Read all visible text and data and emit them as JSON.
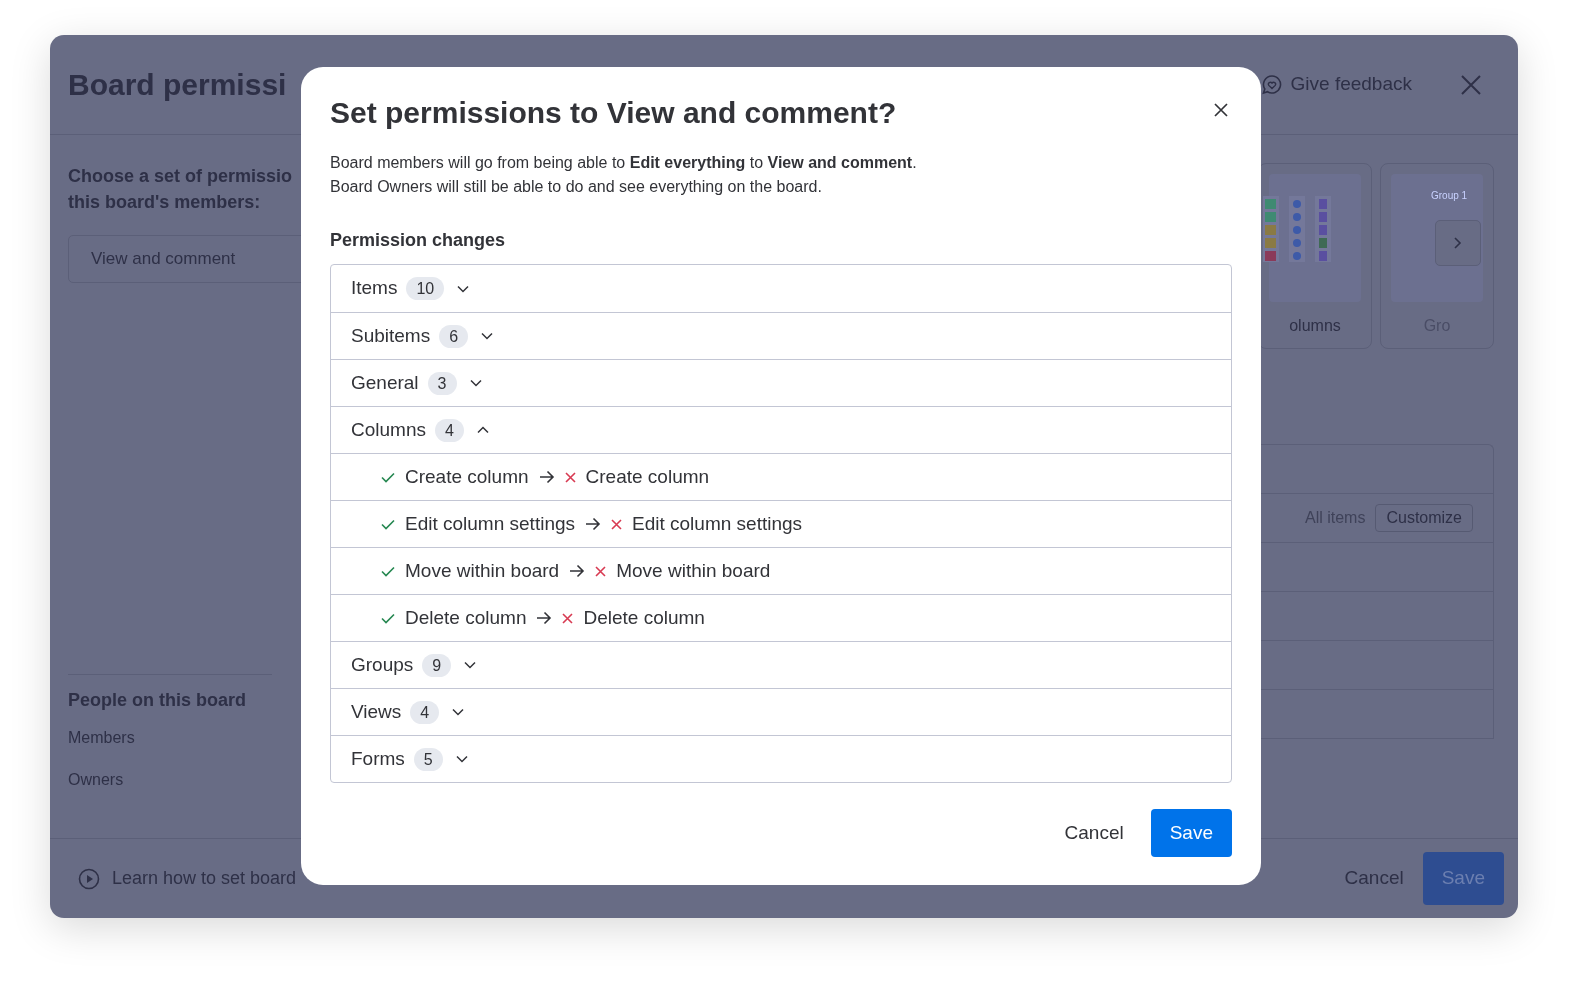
{
  "backdrop": {
    "title": "Board permissi",
    "feedback": "Give feedback",
    "prompt_lines": [
      "Choose a set of permissio",
      "this board's members:"
    ],
    "preset_field": "View and comment",
    "thumbnails": [
      {
        "label": "olumns",
        "kind": "columns"
      },
      {
        "label": "Gro",
        "kind": "groups",
        "preview_text": "Group 1"
      }
    ],
    "view_label": "All items",
    "customize": "Customize",
    "people": {
      "heading": "People on this board",
      "items": [
        "Members",
        "Owners"
      ]
    },
    "learn_link": "Learn how to set board",
    "buttons": [
      "Cancel",
      "Save"
    ]
  },
  "dialog": {
    "title": "Set permissions to View and comment?",
    "description": [
      "Board members will go from being able to **Edit everything** to **View and comment**.",
      "Board Owners will still be able to do and see everything on the board."
    ],
    "section_title": "Permission changes",
    "groups": [
      {
        "label": "Items",
        "count": "10",
        "expanded": false
      },
      {
        "label": "Subitems",
        "count": "6",
        "expanded": false
      },
      {
        "label": "General",
        "count": "3",
        "expanded": false
      },
      {
        "label": "Columns",
        "count": "4",
        "expanded": true,
        "changes": [
          {
            "from": "Create column",
            "to": "Create column"
          },
          {
            "from": "Edit column settings",
            "to": "Edit column settings"
          },
          {
            "from": "Move within board",
            "to": "Move within board"
          },
          {
            "from": "Delete column",
            "to": "Delete column"
          }
        ]
      },
      {
        "label": "Groups",
        "count": "9",
        "expanded": false
      },
      {
        "label": "Views",
        "count": "4",
        "expanded": false
      },
      {
        "label": "Forms",
        "count": "5",
        "expanded": false
      }
    ],
    "buttons": [
      "Cancel",
      "Save"
    ]
  }
}
